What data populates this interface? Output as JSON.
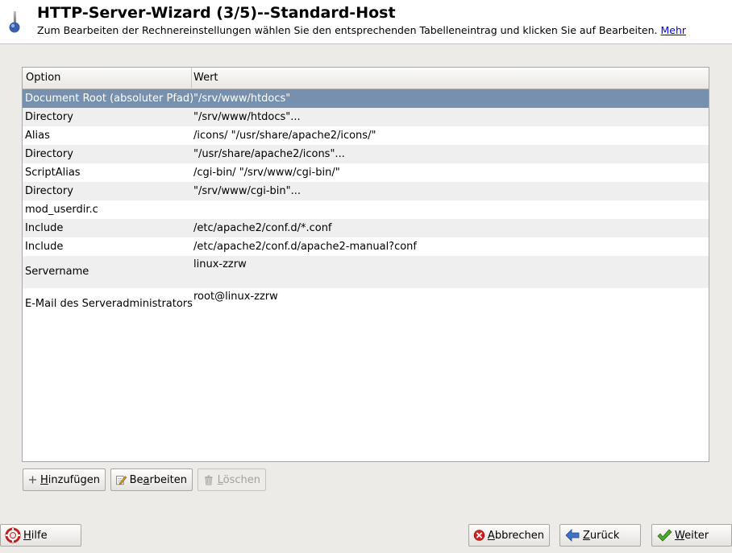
{
  "header": {
    "title": "HTTP-Server-Wizard (3/5)--Standard-Host",
    "subtitle": "Zum Bearbeiten der Rechnereinstellungen wählen Sie den entsprechenden Tabelleneintrag und klicken Sie auf Bearbeiten.",
    "more_link": "Mehr"
  },
  "table": {
    "columns": [
      "Option",
      "Wert"
    ],
    "rows": [
      {
        "option": "Document Root (absoluter Pfad)",
        "value": "\"/srv/www/htdocs\""
      },
      {
        "option": "Directory",
        "value": "\"/srv/www/htdocs\"..."
      },
      {
        "option": "Alias",
        "value": "/icons/ \"/usr/share/apache2/icons/\""
      },
      {
        "option": "Directory",
        "value": "\"/usr/share/apache2/icons\"..."
      },
      {
        "option": "ScriptAlias",
        "value": "/cgi-bin/ \"/srv/www/cgi-bin/\""
      },
      {
        "option": "Directory",
        "value": "\"/srv/www/cgi-bin\"..."
      },
      {
        "option": "mod_userdir.c",
        "value": ""
      },
      {
        "option": "Include",
        "value": "/etc/apache2/conf.d/*.conf"
      },
      {
        "option": "Include",
        "value": "/etc/apache2/conf.d/apache2-manual?conf"
      },
      {
        "option": "Servername",
        "value": "linux-zzrw"
      },
      {
        "option": "E-Mail des Serveradministrators",
        "value": "root@linux-zzrw"
      }
    ]
  },
  "table_buttons": {
    "add": {
      "accel": "H",
      "rest": "inzufügen"
    },
    "edit": {
      "pre": "Be",
      "accel": "a",
      "rest": "rbeiten"
    },
    "delete": {
      "accel": "L",
      "rest": "öschen"
    }
  },
  "footer": {
    "help": {
      "accel": "H",
      "rest": "ilfe"
    },
    "abort": {
      "accel": "A",
      "rest": "bbrechen"
    },
    "back": {
      "accel": "Z",
      "rest": "urück"
    },
    "next": {
      "accel": "W",
      "rest": "eiter"
    }
  },
  "colors": {
    "selection": "#7690ae",
    "alt_row": "#efefef",
    "window_bg": "#edebe7",
    "link": "#0000ee"
  },
  "icons": {
    "app": "apache-feather-icon",
    "add": "plus-icon",
    "edit": "edit-pencil-icon",
    "delete": "trash-icon",
    "help": "lifebuoy-icon",
    "abort": "cancel-circle-icon",
    "back": "arrow-left-icon",
    "next": "checkmark-icon"
  }
}
